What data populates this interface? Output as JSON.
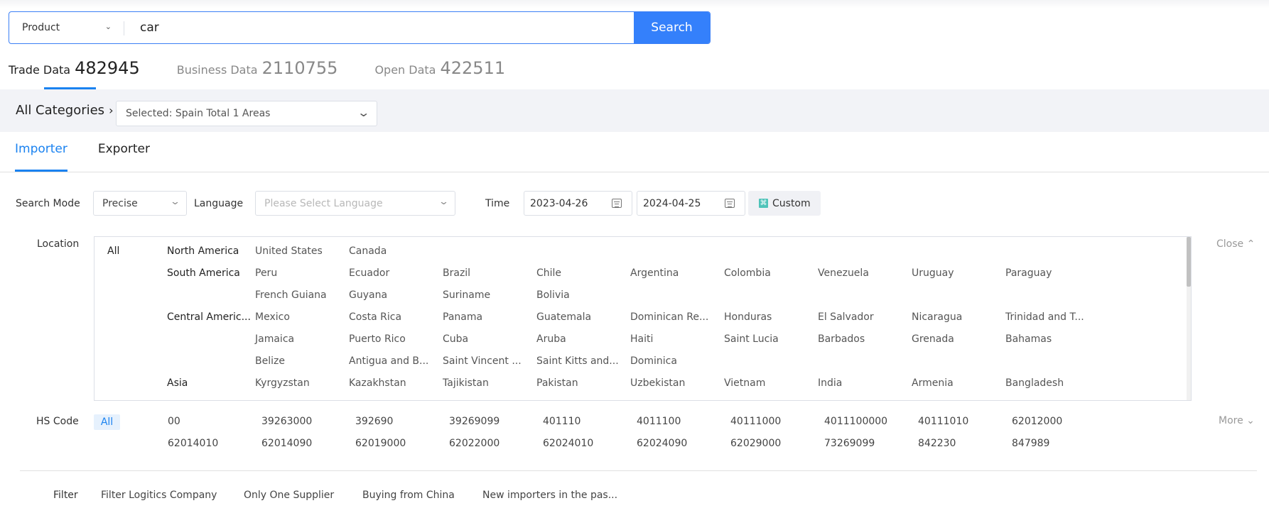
{
  "search": {
    "type_selected": "Product",
    "query": "car",
    "button_label": "Search"
  },
  "data_tabs": [
    {
      "label": "Trade Data",
      "count": "482945",
      "active": true
    },
    {
      "label": "Business Data",
      "count": "2110755",
      "active": false
    },
    {
      "label": "Open Data",
      "count": "422511",
      "active": false
    }
  ],
  "categories": {
    "all_label": "All Categories",
    "selected_text": "Selected:  Spain Total 1 Areas"
  },
  "role_tabs": [
    {
      "label": "Importer",
      "active": true
    },
    {
      "label": "Exporter",
      "active": false
    }
  ],
  "filters": {
    "search_mode_label": "Search Mode",
    "search_mode_value": "Precise",
    "language_label": "Language",
    "language_placeholder": "Please Select Language",
    "time_label": "Time",
    "date_start": "2023-04-26",
    "date_end": "2024-04-25",
    "custom_label": "Custom"
  },
  "location": {
    "label": "Location",
    "all_label": "All",
    "close_label": "Close",
    "rows": [
      {
        "region": "North America",
        "countries": [
          "United States",
          "Canada"
        ]
      },
      {
        "region": "South America",
        "countries": [
          "Peru",
          "Ecuador",
          "Brazil",
          "Chile",
          "Argentina",
          "Colombia",
          "Venezuela",
          "Uruguay",
          "Paraguay"
        ]
      },
      {
        "region": "",
        "countries": [
          "French Guiana",
          "Guyana",
          "Suriname",
          "Bolivia"
        ]
      },
      {
        "region": "Central Americ...",
        "countries": [
          "Mexico",
          "Costa Rica",
          "Panama",
          "Guatemala",
          "Dominican Re...",
          "Honduras",
          "El Salvador",
          "Nicaragua",
          "Trinidad and T..."
        ]
      },
      {
        "region": "",
        "countries": [
          "Jamaica",
          "Puerto Rico",
          "Cuba",
          "Aruba",
          "Haiti",
          "Saint Lucia",
          "Barbados",
          "Grenada",
          "Bahamas"
        ]
      },
      {
        "region": "",
        "countries": [
          "Belize",
          "Antigua and B...",
          "Saint Vincent ...",
          "Saint Kitts and...",
          "Dominica"
        ]
      },
      {
        "region": "Asia",
        "countries": [
          "Kyrgyzstan",
          "Kazakhstan",
          "Tajikistan",
          "Pakistan",
          "Uzbekistan",
          "Vietnam",
          "India",
          "Armenia",
          "Bangladesh"
        ]
      }
    ]
  },
  "hs_code": {
    "label": "HS Code",
    "all_label": "All",
    "more_label": "More",
    "rows": [
      [
        "00",
        "39263000",
        "392690",
        "39269099",
        "401110",
        "4011100",
        "40111000",
        "4011100000",
        "40111010",
        "62012000"
      ],
      [
        "62014010",
        "62014090",
        "62019000",
        "62022000",
        "62024010",
        "62024090",
        "62029000",
        "73269099",
        "842230",
        "847989"
      ]
    ]
  },
  "filter": {
    "label": "Filter",
    "options": [
      "Filter Logitics Company",
      "Only One Supplier",
      "Buying from China",
      "New importers in the pas..."
    ]
  },
  "colors": {
    "accent": "#1a82f0",
    "search_button": "#3480fb",
    "band_bg": "#f2f3f7",
    "custom_icon": "#4fc3b9"
  }
}
